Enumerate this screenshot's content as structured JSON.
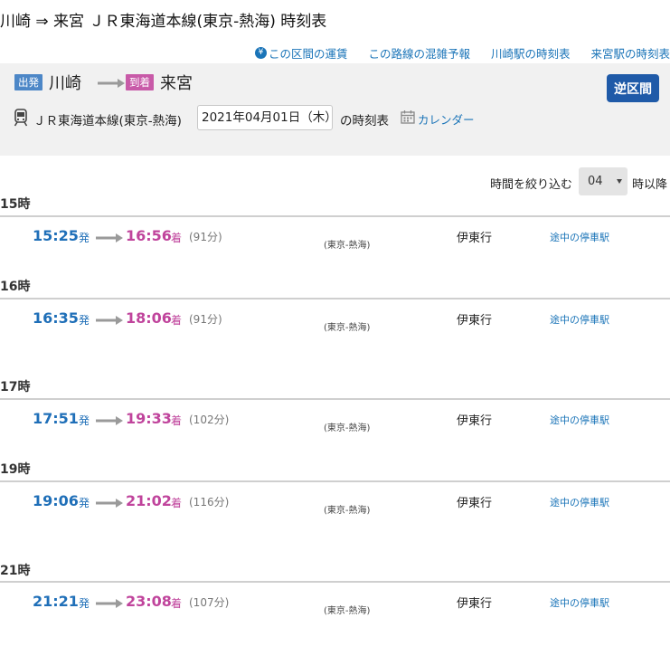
{
  "page": {
    "title": "川崎 ⇒ 来宮 ＪＲ東海道本線(東京-熱海) 時刻表"
  },
  "top_links": [
    {
      "label": "この区間の運賃",
      "icon": "yen-icon"
    },
    {
      "label": "この路線の混雑予報"
    },
    {
      "label": "川崎駅の時刻表"
    },
    {
      "label": "来宮駅の時刻表"
    }
  ],
  "route": {
    "dep_badge": "出発",
    "dep_station": "川崎",
    "arr_badge": "到着",
    "arr_station": "来宮",
    "reverse_label": "逆区間",
    "line_name": "ＪＲ東海道本線(東京-熱海)",
    "date_value": "2021年04月01日（木）",
    "date_suffix": "の時刻表",
    "calendar_label": "カレンダー"
  },
  "filter": {
    "label": "時間を絞り込む",
    "value": "04",
    "suffix": "時以降"
  },
  "colors": {
    "departure": "#1f6fb8",
    "arrival": "#c0449c",
    "link": "#1a74b8",
    "reverse_button": "#1f5aa8"
  },
  "hours": [
    {
      "label": "15時",
      "trains": [
        {
          "dep": "15:25",
          "dep_label": "発",
          "arr": "16:56",
          "arr_label": "着",
          "duration": "(91分)",
          "section": "(東京-熱海)",
          "dest": "伊東行",
          "stops": "途中の停車駅"
        }
      ]
    },
    {
      "label": "16時",
      "trains": [
        {
          "dep": "16:35",
          "dep_label": "発",
          "arr": "18:06",
          "arr_label": "着",
          "duration": "(91分)",
          "section": "(東京-熱海)",
          "dest": "伊東行",
          "stops": "途中の停車駅"
        }
      ]
    },
    {
      "label": "17時",
      "trains": [
        {
          "dep": "17:51",
          "dep_label": "発",
          "arr": "19:33",
          "arr_label": "着",
          "duration": "(102分)",
          "section": "(東京-熱海)",
          "dest": "伊東行",
          "stops": "途中の停車駅"
        }
      ]
    },
    {
      "label": "19時",
      "trains": [
        {
          "dep": "19:06",
          "dep_label": "発",
          "arr": "21:02",
          "arr_label": "着",
          "duration": "(116分)",
          "section": "(東京-熱海)",
          "dest": "伊東行",
          "stops": "途中の停車駅"
        }
      ]
    },
    {
      "label": "21時",
      "trains": [
        {
          "dep": "21:21",
          "dep_label": "発",
          "arr": "23:08",
          "arr_label": "着",
          "duration": "(107分)",
          "section": "(東京-熱海)",
          "dest": "伊東行",
          "stops": "途中の停車駅"
        }
      ]
    }
  ]
}
